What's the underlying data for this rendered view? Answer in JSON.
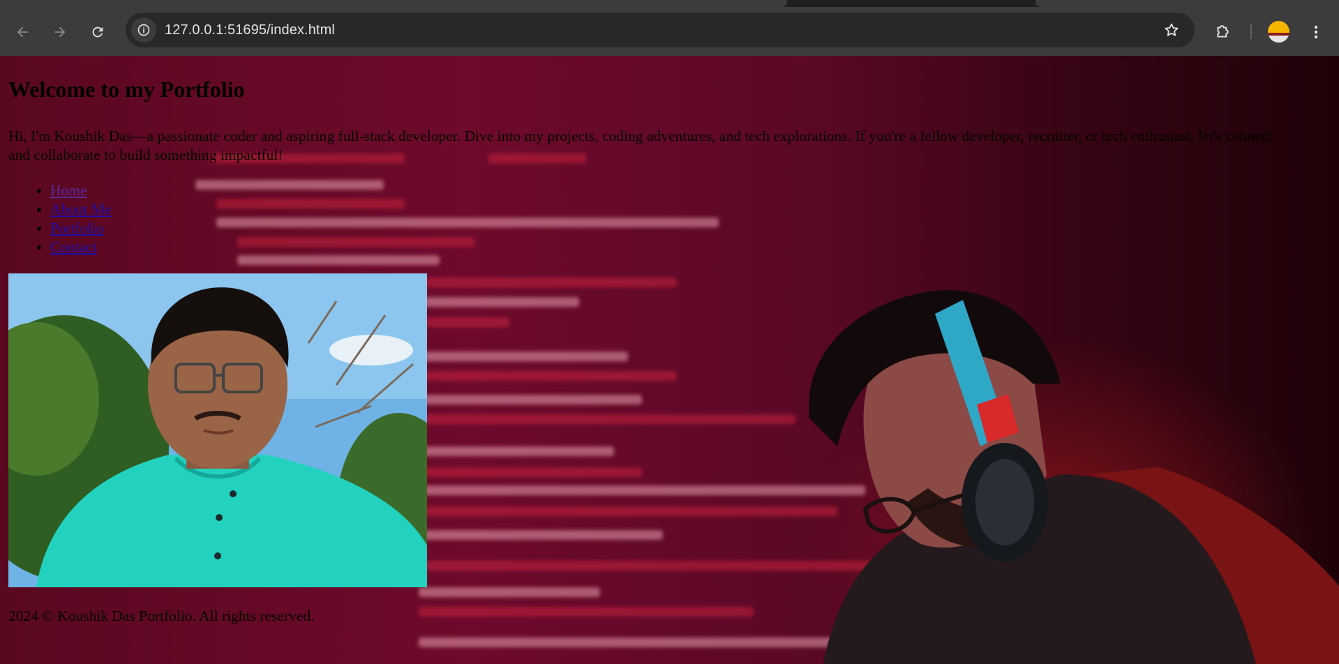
{
  "browser": {
    "url": "127.0.0.1:51695/index.html",
    "icons": {
      "back": "back-arrow-icon",
      "forward": "forward-arrow-icon",
      "reload": "reload-icon",
      "site_info": "info-icon",
      "bookmark": "star-icon",
      "extensions": "puzzle-icon",
      "profile": "avatar",
      "menu": "kebab-menu-icon"
    }
  },
  "page": {
    "title": "Welcome to my Portfolio",
    "intro": "Hi, I'm Koushik Das—a passionate coder and aspiring full-stack developer. Dive into my projects, coding adventures, and tech explorations. If you're a fellow developer, recruiter, or tech enthusiast, let's connect and collaborate to build something impactful!",
    "nav": [
      {
        "label": "Home"
      },
      {
        "label": "About Me"
      },
      {
        "label": "Portfolio"
      },
      {
        "label": "Contact"
      }
    ],
    "footer": "2024 © Koushik Das Portfolio. All rights reserved.",
    "colors": {
      "link": "#1a0dab",
      "visited_link": "#5a2ba0",
      "background_tint": "#6e0a2c"
    }
  }
}
